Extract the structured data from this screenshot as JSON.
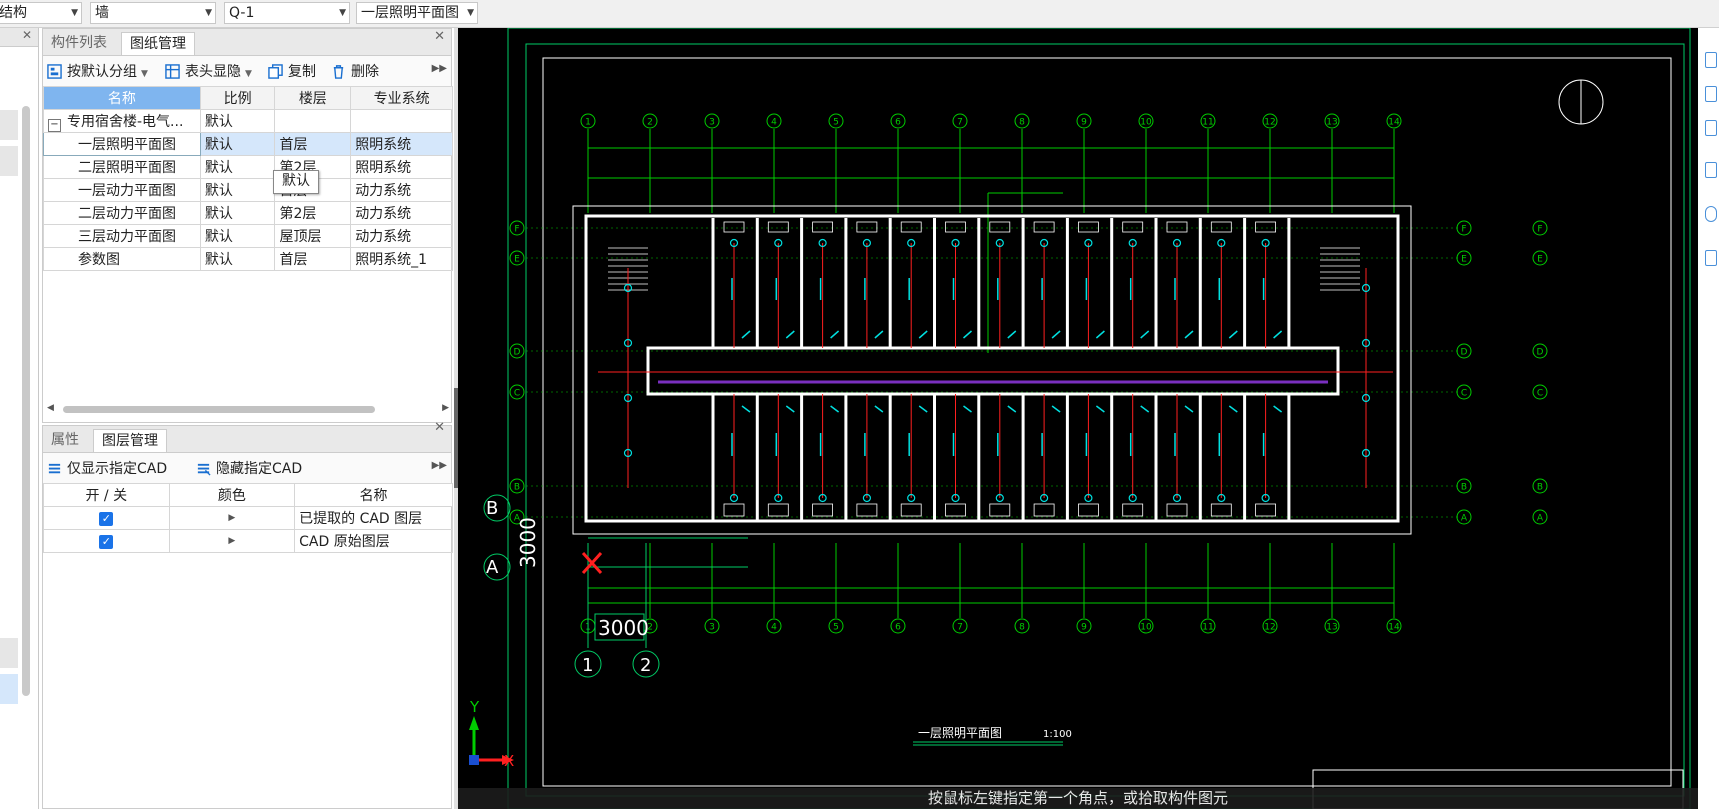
{
  "topbar": {
    "combos": [
      "结构",
      "墙",
      "Q-1",
      "一层照明平面图"
    ]
  },
  "drawing_panel": {
    "tabs": [
      "构件列表",
      "图纸管理"
    ],
    "active_tab": "图纸管理",
    "toolbar": {
      "group_label": "按默认分组",
      "header_label": "表头显隐",
      "copy_label": "复制",
      "delete_label": "删除"
    },
    "columns": [
      "名称",
      "比例",
      "楼层",
      "专业系统"
    ],
    "group_row": {
      "name": "专用宿舍楼-电气...",
      "scale": "默认"
    },
    "rows": [
      {
        "name": "一层照明平面图",
        "scale": "默认",
        "floor": "首层",
        "system": "照明系统"
      },
      {
        "name": "二层照明平面图",
        "scale": "默认",
        "floor": "第2层",
        "system": "照明系统"
      },
      {
        "name": "一层动力平面图",
        "scale": "默认",
        "floor": "首层",
        "system": "动力系统"
      },
      {
        "name": "二层动力平面图",
        "scale": "默认",
        "floor": "第2层",
        "system": "动力系统"
      },
      {
        "name": "三层动力平面图",
        "scale": "默认",
        "floor": "屋顶层",
        "system": "动力系统"
      },
      {
        "name": "参数图",
        "scale": "默认",
        "floor": "首层",
        "system": "照明系统_1"
      }
    ],
    "tooltip": "默认"
  },
  "layer_panel": {
    "tabs": [
      "属性",
      "图层管理"
    ],
    "active_tab": "图层管理",
    "toolbar": {
      "show_only_label": "仅显示指定CAD",
      "hide_label": "隐藏指定CAD"
    },
    "columns": [
      "开 / 关",
      "颜色",
      "名称"
    ],
    "rows": [
      {
        "checked": true,
        "name": "已提取的 CAD 图层"
      },
      {
        "checked": true,
        "name": "CAD 原始图层"
      }
    ]
  },
  "cad": {
    "grid_numbers": [
      "1",
      "2",
      "3",
      "4",
      "5",
      "6",
      "7",
      "8",
      "9",
      "10",
      "11",
      "12",
      "13",
      "14"
    ],
    "row_letters": [
      "F",
      "E",
      "D",
      "C",
      "B",
      "A"
    ],
    "dim_label": "3000",
    "dim_vertical": "3000",
    "axis_b": "B",
    "axis_a": "A",
    "axis_1": "1",
    "axis_2": "2",
    "axis_x": "X",
    "axis_y": "Y",
    "drawing_title": "一层照明平面图",
    "scale_text": "1:100",
    "status_prompt": "按鼠标左键指定第一个角点，或拾取构件图元",
    "colors": {
      "wall": "#ffffff",
      "grid": "#00cc00",
      "wiring": "#ff2020",
      "fixture": "#00e0e0",
      "cursor": "#ff2020"
    }
  }
}
